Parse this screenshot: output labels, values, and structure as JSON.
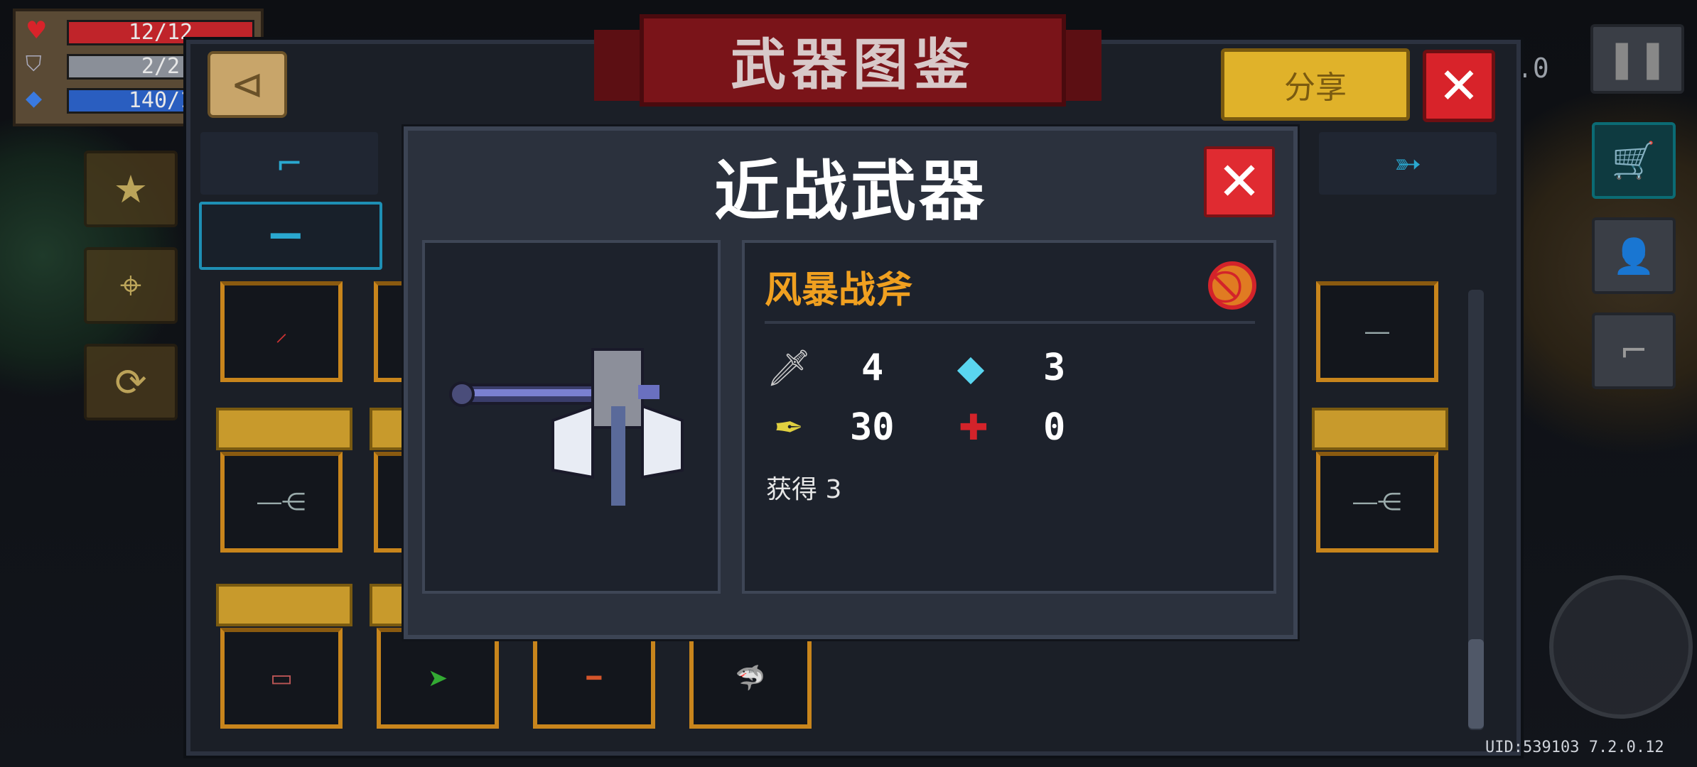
{
  "hud": {
    "health": "12/12",
    "armor": "2/2",
    "energy": "140/1"
  },
  "header": {
    "title": "武器图鉴",
    "share_label": "分享",
    "close_symbol": "✕",
    "back_symbol": "⊲",
    "right_value": ".0"
  },
  "tabs": [
    {
      "icon": "pistol-icon",
      "selected": false
    },
    {
      "icon": "sword-icon",
      "selected": true
    },
    {
      "icon": "arrow-weapon-icon",
      "selected": false
    }
  ],
  "modal": {
    "title": "近战武器",
    "close_symbol": "✕",
    "weapon_name": "风暴战斧",
    "stats": {
      "damage": "4",
      "energy_cost": "3",
      "crit": "30",
      "spread": "0"
    },
    "obtained_label": "获得 3"
  },
  "footer": {
    "uid": "UID:539103 7.2.0.12"
  },
  "colors": {
    "accent_gold": "#e0b22a",
    "danger_red": "#d8232a",
    "weapon_name": "#f0a020",
    "panel_bg": "#1b1f27"
  }
}
